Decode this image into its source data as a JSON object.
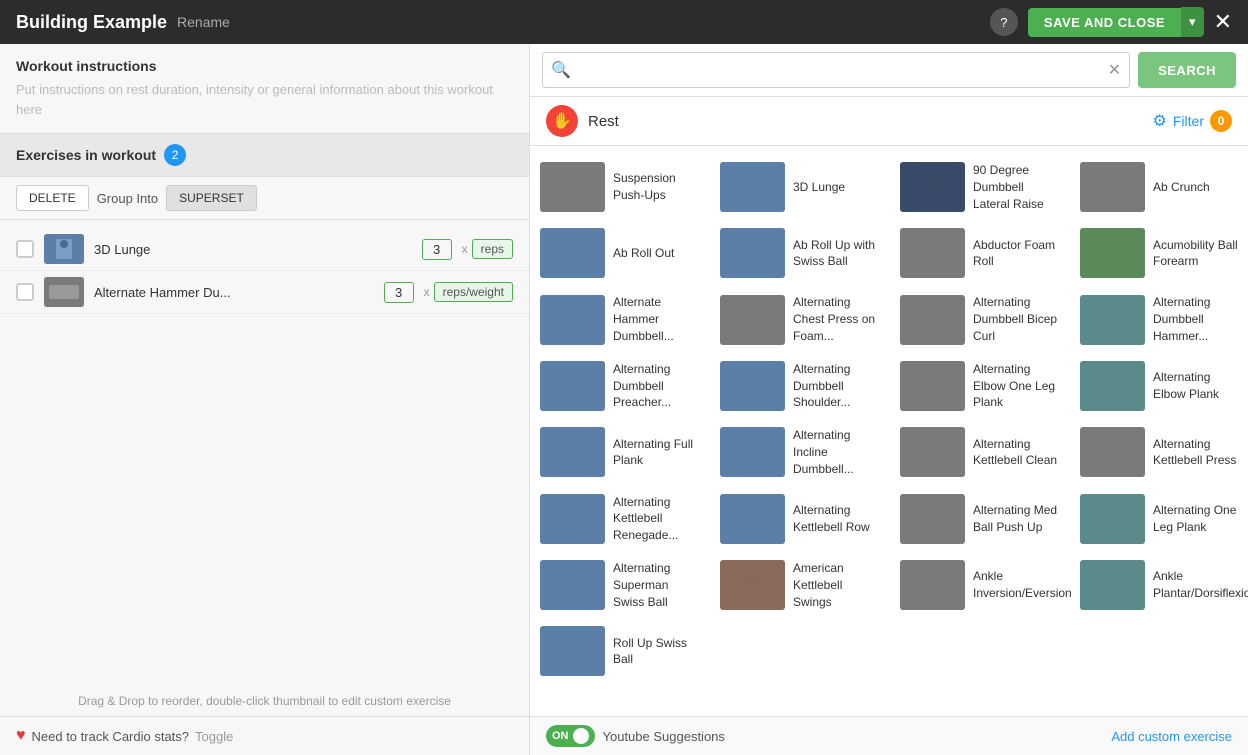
{
  "header": {
    "title": "Building Example",
    "rename_label": "Rename",
    "save_close_label": "SAVE AND CLOSE",
    "help_label": "?",
    "close_label": "✕"
  },
  "left": {
    "instructions_label": "Workout instructions",
    "instructions_placeholder": "Put instructions on rest duration, intensity or general information about this workout here",
    "exercises_title": "Exercises in workout",
    "exercises_count": "2",
    "toolbar": {
      "delete_label": "DELETE",
      "group_into_label": "Group Into",
      "superset_label": "SUPERSET"
    },
    "exercises": [
      {
        "name": "3D Lunge",
        "sets": "3",
        "unit": "reps"
      },
      {
        "name": "Alternate Hammer Du...",
        "sets": "3",
        "unit": "reps/weight"
      }
    ],
    "drag_hint": "Drag & Drop to reorder, double-click thumbnail to edit custom exercise",
    "cardio_text": "Need to track Cardio stats?",
    "toggle_label": "Toggle"
  },
  "right": {
    "search_placeholder": "",
    "search_button_label": "SEARCH",
    "rest_label": "Rest",
    "filter_label": "Filter",
    "filter_count": "0",
    "youtube_label": "Youtube Suggestions",
    "youtube_toggle_label": "ON",
    "add_custom_label": "Add custom exercise",
    "exercises": [
      {
        "name": "Suspension Push-Ups",
        "thumb_color": "thumb-gray"
      },
      {
        "name": "3D Lunge",
        "thumb_color": "thumb-blue"
      },
      {
        "name": "90 Degree Dumbbell Lateral Raise",
        "thumb_color": "thumb-navy"
      },
      {
        "name": "Ab Crunch",
        "thumb_color": "thumb-gray"
      },
      {
        "name": "Ab Roll Out",
        "thumb_color": "thumb-blue"
      },
      {
        "name": "Ab Roll Up with Swiss Ball",
        "thumb_color": "thumb-blue"
      },
      {
        "name": "Abductor Foam Roll",
        "thumb_color": "thumb-gray"
      },
      {
        "name": "Acumobility Ball Forearm",
        "thumb_color": "thumb-green"
      },
      {
        "name": "Alternate Hammer Dumbbell...",
        "thumb_color": "thumb-blue"
      },
      {
        "name": "Alternating Chest Press on Foam...",
        "thumb_color": "thumb-gray"
      },
      {
        "name": "Alternating Dumbbell Bicep Curl",
        "thumb_color": "thumb-gray"
      },
      {
        "name": "Alternating Dumbbell Hammer...",
        "thumb_color": "thumb-teal"
      },
      {
        "name": "Alternating Dumbbell Preacher...",
        "thumb_color": "thumb-blue"
      },
      {
        "name": "Alternating Dumbbell Shoulder...",
        "thumb_color": "thumb-blue"
      },
      {
        "name": "Alternating Elbow One Leg Plank",
        "thumb_color": "thumb-gray"
      },
      {
        "name": "Alternating Elbow Plank",
        "thumb_color": "thumb-teal"
      },
      {
        "name": "Alternating Full Plank",
        "thumb_color": "thumb-blue"
      },
      {
        "name": "Alternating Incline Dumbbell...",
        "thumb_color": "thumb-blue"
      },
      {
        "name": "Alternating Kettlebell Clean",
        "thumb_color": "thumb-gray"
      },
      {
        "name": "Alternating Kettlebell Press",
        "thumb_color": "thumb-gray"
      },
      {
        "name": "Alternating Kettlebell Renegade...",
        "thumb_color": "thumb-blue"
      },
      {
        "name": "Alternating Kettlebell Row",
        "thumb_color": "thumb-blue"
      },
      {
        "name": "Alternating Med Ball Push Up",
        "thumb_color": "thumb-gray"
      },
      {
        "name": "Alternating One Leg Plank",
        "thumb_color": "thumb-teal"
      },
      {
        "name": "Alternating Superman Swiss Ball",
        "thumb_color": "thumb-blue"
      },
      {
        "name": "American Kettlebell Swings",
        "thumb_color": "thumb-brown"
      },
      {
        "name": "Ankle Inversion/Eversion",
        "thumb_color": "thumb-gray"
      },
      {
        "name": "Ankle Plantar/Dorsiflexion",
        "thumb_color": "thumb-teal"
      },
      {
        "name": "Roll Up Swiss Ball",
        "thumb_color": "thumb-blue"
      }
    ]
  }
}
